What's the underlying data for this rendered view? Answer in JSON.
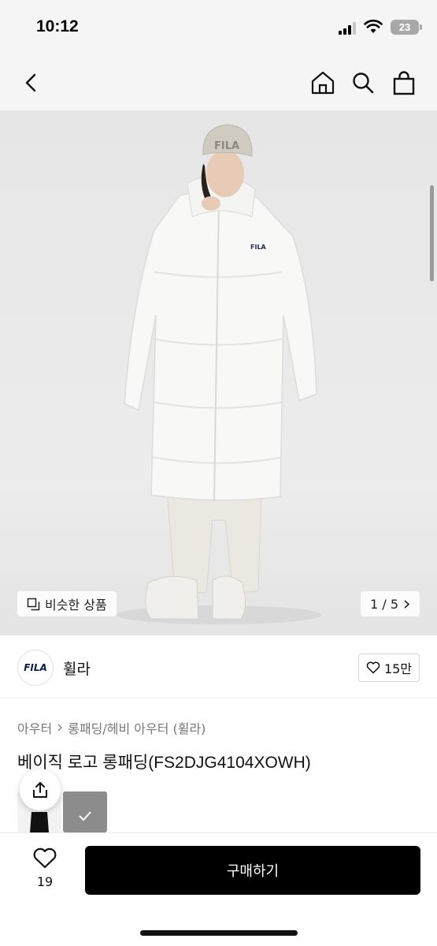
{
  "status_bar": {
    "time": "10:12",
    "battery": "23"
  },
  "nav": {
    "icons": [
      "back-icon",
      "home-icon",
      "search-icon",
      "shopping-bag-icon"
    ]
  },
  "gallery": {
    "similar_label": "비슷한 상품",
    "page_indicator": "1 / 5",
    "logo_text": "FILA",
    "jacket_logo": "FILA"
  },
  "brand": {
    "logo_text": "FILA",
    "name": "휠라",
    "like_count": "15만"
  },
  "breadcrumb": {
    "level1": "아우터",
    "level2": "롱패딩/헤비 아우터 (휠라)"
  },
  "product": {
    "title": "베이직 로고 롱패딩(FS2DJG4104XOWH)"
  },
  "bottom": {
    "wish_count": "19",
    "buy_label": "구매하기"
  },
  "colors": {
    "buy_button": "#000000",
    "background": "#ffffff",
    "header_bg": "#f5f5f5"
  }
}
